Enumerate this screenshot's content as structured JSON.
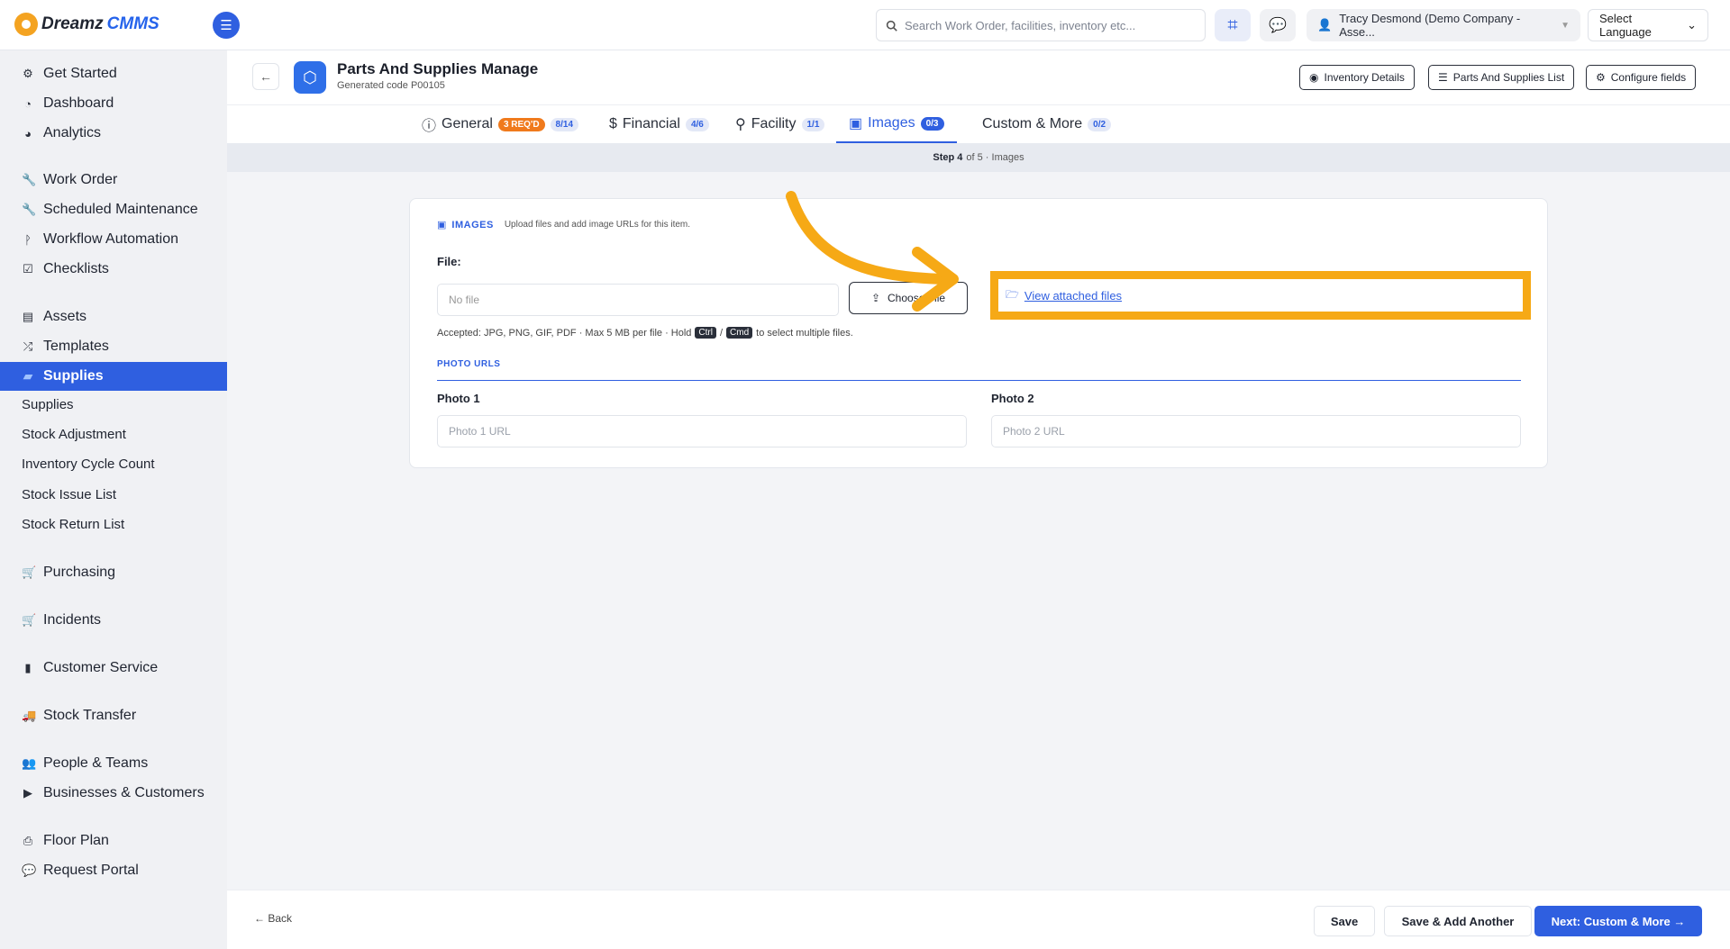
{
  "app": {
    "logo_a": "Dreamz",
    "logo_b": "CMMS",
    "search_placeholder": "Search Work Order, facilities, inventory etc...",
    "user_label": "Tracy Desmond (Demo Company - Asse...",
    "language": "Select Language"
  },
  "sidebar": {
    "items": [
      {
        "label": "Get Started",
        "icon": "gears-icon"
      },
      {
        "label": "Dashboard",
        "icon": "dashboard-icon"
      },
      {
        "label": "Analytics",
        "icon": "analytics-icon"
      },
      {
        "label": "Work Order",
        "icon": "wrench-icon"
      },
      {
        "label": "Scheduled Maintenance",
        "icon": "wrench-icon"
      },
      {
        "label": "Workflow Automation",
        "icon": "branch-icon"
      },
      {
        "label": "Checklists",
        "icon": "checkbox-icon"
      },
      {
        "label": "Assets",
        "icon": "archive-icon"
      },
      {
        "label": "Templates",
        "icon": "shuffle-icon"
      },
      {
        "label": "Supplies",
        "icon": "supplies-icon"
      },
      {
        "label": "Purchasing",
        "icon": "cart-icon"
      },
      {
        "label": "Incidents",
        "icon": "cart-icon"
      },
      {
        "label": "Customer Service",
        "icon": "file-icon"
      },
      {
        "label": "Stock Transfer",
        "icon": "truck-icon"
      },
      {
        "label": "People & Teams",
        "icon": "users-icon"
      },
      {
        "label": "Businesses & Customers",
        "icon": "video-icon"
      },
      {
        "label": "Floor Plan",
        "icon": "print-icon"
      },
      {
        "label": "Request Portal",
        "icon": "comment-icon"
      }
    ],
    "sub_items": [
      "Supplies",
      "Stock Adjustment",
      "Inventory Cycle Count",
      "Stock Issue List",
      "Stock Return List"
    ]
  },
  "header": {
    "title": "Parts And Supplies Manage",
    "subtitle": "Generated code P00105",
    "btn_inventory": "Inventory Details",
    "btn_list": "Parts And Supplies List",
    "btn_configure": "Configure fields"
  },
  "tabs": [
    {
      "label": "General",
      "badge1": "3 REQ'D",
      "badge2": "8/14"
    },
    {
      "label": "Financial",
      "badge": "4/6"
    },
    {
      "label": "Facility",
      "badge": "1/1"
    },
    {
      "label": "Images",
      "badge": "0/3"
    },
    {
      "label": "Custom & More",
      "badge": "0/2"
    }
  ],
  "step": {
    "bold": "Step 4",
    "rest": "of 5 · Images"
  },
  "images": {
    "section_title": "IMAGES",
    "section_desc": "Upload files and add image URLs for this item.",
    "file_label": "File:",
    "file_value": "No file",
    "choose_label": "Choose File",
    "view_files": "View attached files",
    "hint_a": "Accepted: JPG, PNG, GIF, PDF  ·  Max 5 MB per file  ·  Hold",
    "kbd_ctrl": "Ctrl",
    "hint_slash": "/",
    "kbd_cmd": "Cmd",
    "hint_b": "to select multiple files.",
    "photo_urls": "PHOTO URLS",
    "photo1_label": "Photo 1",
    "photo1_placeholder": "Photo 1 URL",
    "photo2_label": "Photo 2",
    "photo2_placeholder": "Photo 2 URL"
  },
  "footer": {
    "back": "← Back",
    "save": "Save",
    "save_add": "Save & Add Another",
    "next": "Next: Custom & More →"
  },
  "colors": {
    "accent": "#2f5fe0",
    "highlight": "#f6a916",
    "badge_orange": "#f07a1c"
  }
}
